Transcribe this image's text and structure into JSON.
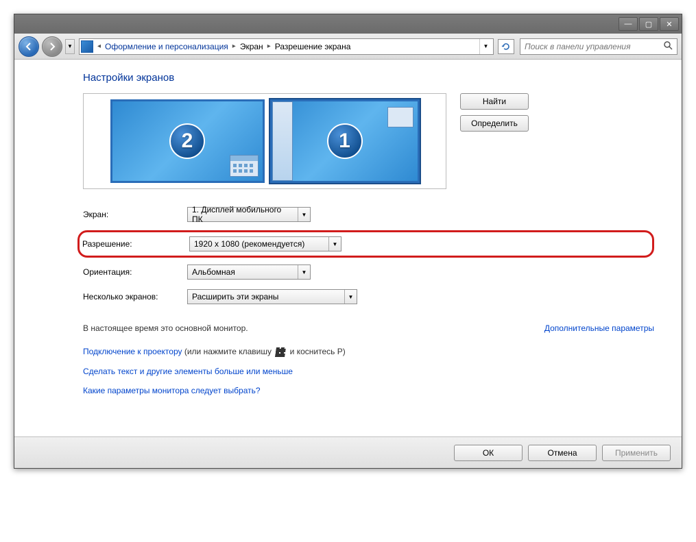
{
  "window_controls": {
    "minimize": "—",
    "maximize": "▢",
    "close": "✕"
  },
  "breadcrumb": {
    "appearance": "Оформление и персонализация",
    "screen": "Экран",
    "resolution": "Разрешение экрана"
  },
  "search": {
    "placeholder": "Поиск в панели управления"
  },
  "heading": "Настройки экранов",
  "monitors": {
    "m1": "2",
    "m2": "1"
  },
  "buttons": {
    "find": "Найти",
    "identify": "Определить",
    "ok": "ОК",
    "cancel": "Отмена",
    "apply": "Применить"
  },
  "form": {
    "screen_label": "Экран:",
    "screen_value": "1. Дисплей мобильного ПК",
    "resolution_label": "Разрешение:",
    "resolution_value": "1920 x 1080 (рекомендуется)",
    "orientation_label": "Ориентация:",
    "orientation_value": "Альбомная",
    "multi_label": "Несколько экранов:",
    "multi_value": "Расширить эти экраны"
  },
  "note": {
    "primary": "В настоящее время это основной монитор.",
    "advanced": "Дополнительные параметры"
  },
  "links": {
    "projector_link": "Подключение к проектору",
    "projector_rest_a": " (или нажмите клавишу ",
    "projector_rest_b": " и коснитесь P)",
    "bigger": "Сделать текст и другие элементы больше или меньше",
    "which": "Какие параметры монитора следует выбрать?"
  }
}
